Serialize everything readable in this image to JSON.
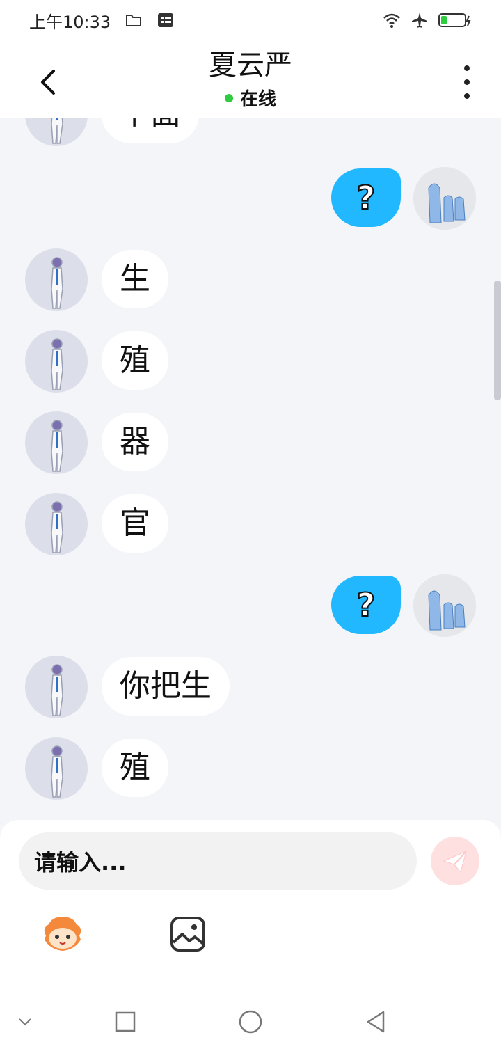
{
  "status_bar": {
    "time": "上午10:33",
    "icons": [
      "folder-icon",
      "notification-icon",
      "wifi-icon",
      "airplane-icon",
      "battery-icon"
    ]
  },
  "header": {
    "title": "夏云严",
    "status": "在线",
    "status_color": "#2ecc40"
  },
  "messages": [
    {
      "side": "left",
      "text": "下面"
    },
    {
      "side": "right",
      "text": "?"
    },
    {
      "side": "left",
      "text": "生"
    },
    {
      "side": "left",
      "text": "殖"
    },
    {
      "side": "left",
      "text": "器"
    },
    {
      "side": "left",
      "text": "官"
    },
    {
      "side": "right",
      "text": "?"
    },
    {
      "side": "left",
      "text": "你把生"
    },
    {
      "side": "left",
      "text": "殖"
    }
  ],
  "input": {
    "placeholder": "请输入..."
  },
  "toolbar": {
    "items": [
      "emoji-icon",
      "image-icon"
    ]
  },
  "colors": {
    "accent_bubble": "#22b8ff",
    "background": "#f3f5f8"
  }
}
